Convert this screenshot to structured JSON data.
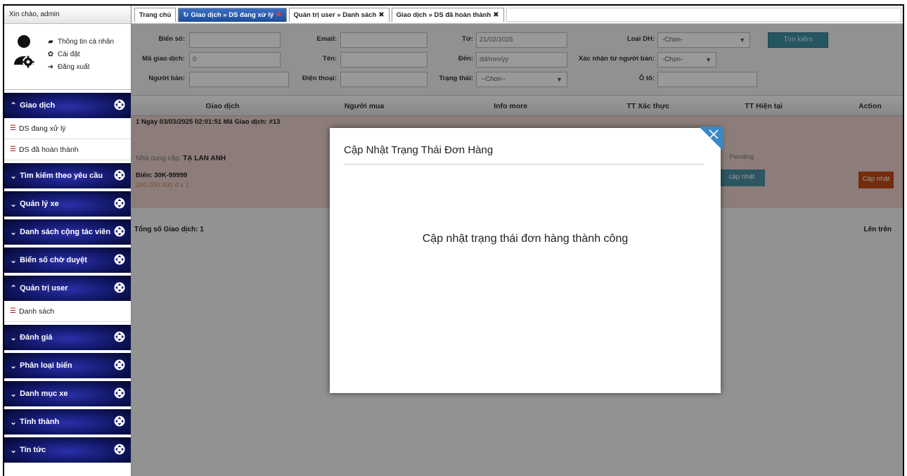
{
  "sidebar": {
    "greeting": "Xin chào, admin",
    "profile_links": [
      {
        "label": "Thông tin cá nhân",
        "icon": "comment-icon"
      },
      {
        "label": "Cài đặt",
        "icon": "gear-icon"
      },
      {
        "label": "Đăng xuất",
        "icon": "sign-out-icon"
      }
    ],
    "groups": {
      "giao_dich": "Giao dịch",
      "ds_dang_xu_ly": "DS đang xử lý",
      "ds_da_hoan_thanh": "DS đã hoàn thành",
      "tim_kiem": "Tìm kiếm theo yêu cầu",
      "quan_ly_xe": "Quản lý xe",
      "cong_tac_vien": "Danh sách cộng tác viên",
      "bien_so": "Biển số chờ duyệt",
      "quan_tri_user": "Quản trị user",
      "danh_sach": "Danh sách",
      "danh_gia": "Đánh giá",
      "phan_loai_bien": "Phân loại biển",
      "danh_muc_xe": "Danh mục xe",
      "tinh_thanh": "Tỉnh thành",
      "tin_tuc": "Tin tức"
    }
  },
  "tabs": {
    "home": "Trang chủ",
    "active": "Giao dịch » DS đang xử lý",
    "users": "Quản trị user » Danh sách",
    "done": "Giao dịch » DS đã hoàn thành",
    "close_glyph": "✖",
    "refresh_glyph": "↻"
  },
  "filters": {
    "bien_so_label": "Biển số:",
    "ma_gd_label": "Mã giao dịch:",
    "ma_gd_value": "0",
    "nguoi_ban_label": "Người bán:",
    "email_label": "Email:",
    "ten_label": "Tên:",
    "dien_thoai_label": "Điện thoại:",
    "tu_label": "Từ:",
    "tu_value": "21/02/2025",
    "den_label": "Đến:",
    "den_placeholder": "dd/mm/yy",
    "trang_thai_label": "Trạng thái:",
    "trang_thai_value": "--Chọn--",
    "loai_dh_label": "Loại DH:",
    "loai_dh_value": "-Chọn-",
    "xac_nhan_label": "Xác nhận từ người bán:",
    "xac_nhan_value": "-Chọn-",
    "oto_label": "Ô tô:",
    "search_button": "Tìm kiếm"
  },
  "table": {
    "columns": [
      "Giao dịch",
      "Người mua",
      "Info more",
      "TT Xác thực",
      "TT Hiện tại",
      "Action"
    ],
    "row": {
      "header": "1   Ngày 03/03/2025 02:01:51   Mã Giao dịch: #13",
      "supplier_label": "Nhà cung cấp:",
      "supplier_name": "TẠ LAN ANH",
      "plate": "Biển: 30K-99999",
      "price": "200.000.000 đ x 1",
      "status_partial": ": Pending",
      "update_partial": "cập nhật",
      "action_button": "Cập nhật"
    },
    "total": "Tổng số Giao dịch: 1",
    "up_button": "Lên trên"
  },
  "modal": {
    "title": "Cập Nhật Trạng Thái Đơn Hàng",
    "message": "Cập nhật trạng thái đơn hàng thành công"
  },
  "colors": {
    "sidebar_group": "#111766",
    "active_tab": "#1d4d9b",
    "row_highlight": "#e9d0cc",
    "search_button": "#3d8fa4",
    "action_button": "#c24a14"
  }
}
